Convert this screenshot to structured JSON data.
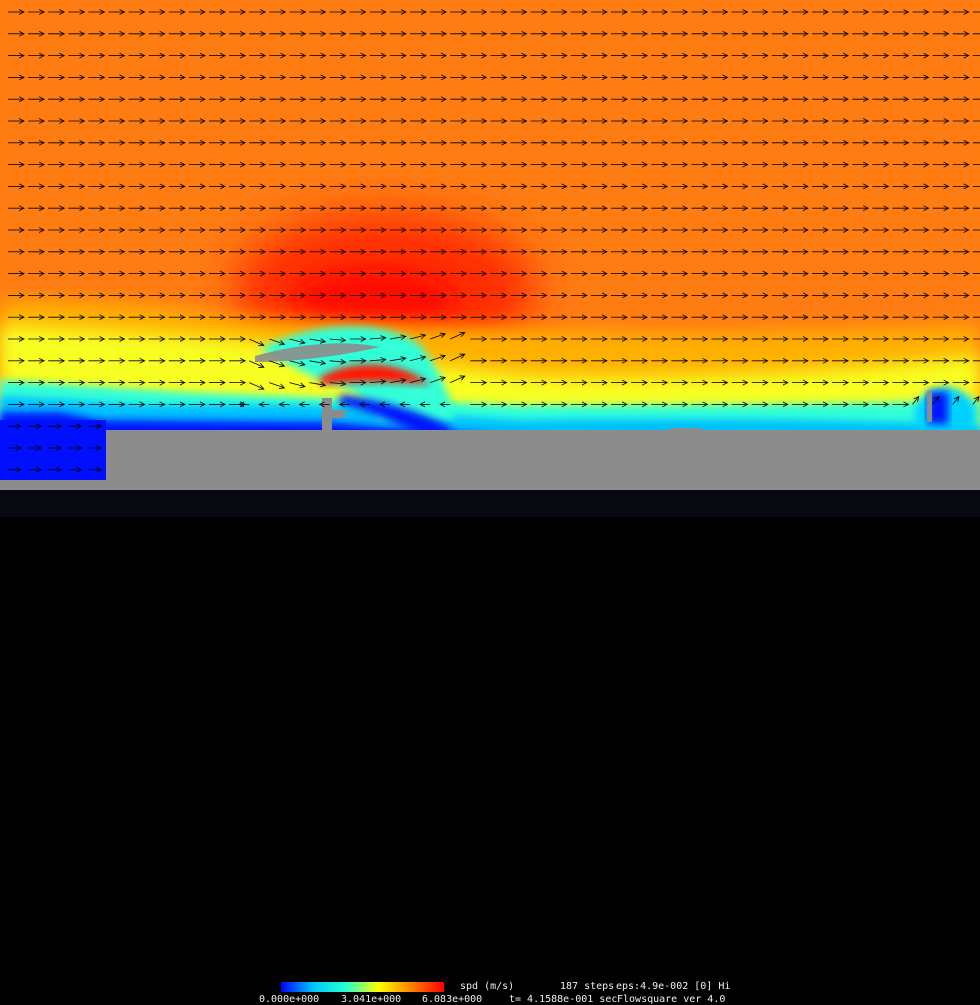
{
  "app": {
    "name": "Flowsquare ver 4.0"
  },
  "colorbar": {
    "variable": "spd (m/s)",
    "min_label": "0.000e+000",
    "mid_label": "3.041e+000",
    "max_label": "6.083e+000",
    "colors": [
      "#0000ff",
      "#00c8ff",
      "#28ffd0",
      "#ffff00",
      "#ff8000",
      "#ff0000"
    ]
  },
  "status": {
    "steps": "187 steps",
    "eps": "eps:4.9e-002 [0] Hi",
    "time": "t= 4.1588e-001 sec"
  },
  "field_colors": {
    "solid": "#8c8c8c",
    "freestream": "#ff7c12",
    "hot": "#ff1a00",
    "low": "#0014ff",
    "arrow": "#000000"
  }
}
